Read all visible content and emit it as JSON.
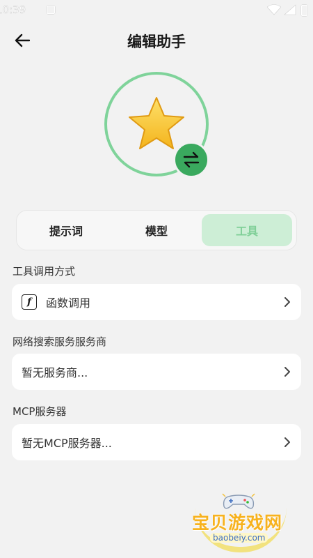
{
  "status_bar": {
    "time": "10:39"
  },
  "header": {
    "title": "编辑助手"
  },
  "tabs": [
    {
      "label": "提示词",
      "active": false
    },
    {
      "label": "模型",
      "active": false
    },
    {
      "label": "工具",
      "active": true
    }
  ],
  "sections": {
    "tool_call": {
      "label": "工具调用方式",
      "value": "函数调用",
      "icon_glyph": "f"
    },
    "web_search": {
      "label": "网络搜索服务服务商",
      "value": "暂无服务商..."
    },
    "mcp": {
      "label": "MCP服务器",
      "value": "暂无MCP服务器..."
    }
  },
  "watermark": {
    "brand": "宝贝游戏网",
    "url": "baobeiy.com"
  },
  "colors": {
    "accent": "#3aa95e",
    "ring": "#7fd39a",
    "active_tab_bg": "#cdeed6",
    "active_tab_text": "#7fcf97",
    "star": "#f8c32c"
  },
  "icons": [
    "back-arrow-icon",
    "star-icon",
    "swap-icon",
    "function-icon",
    "chevron-right-icon"
  ]
}
